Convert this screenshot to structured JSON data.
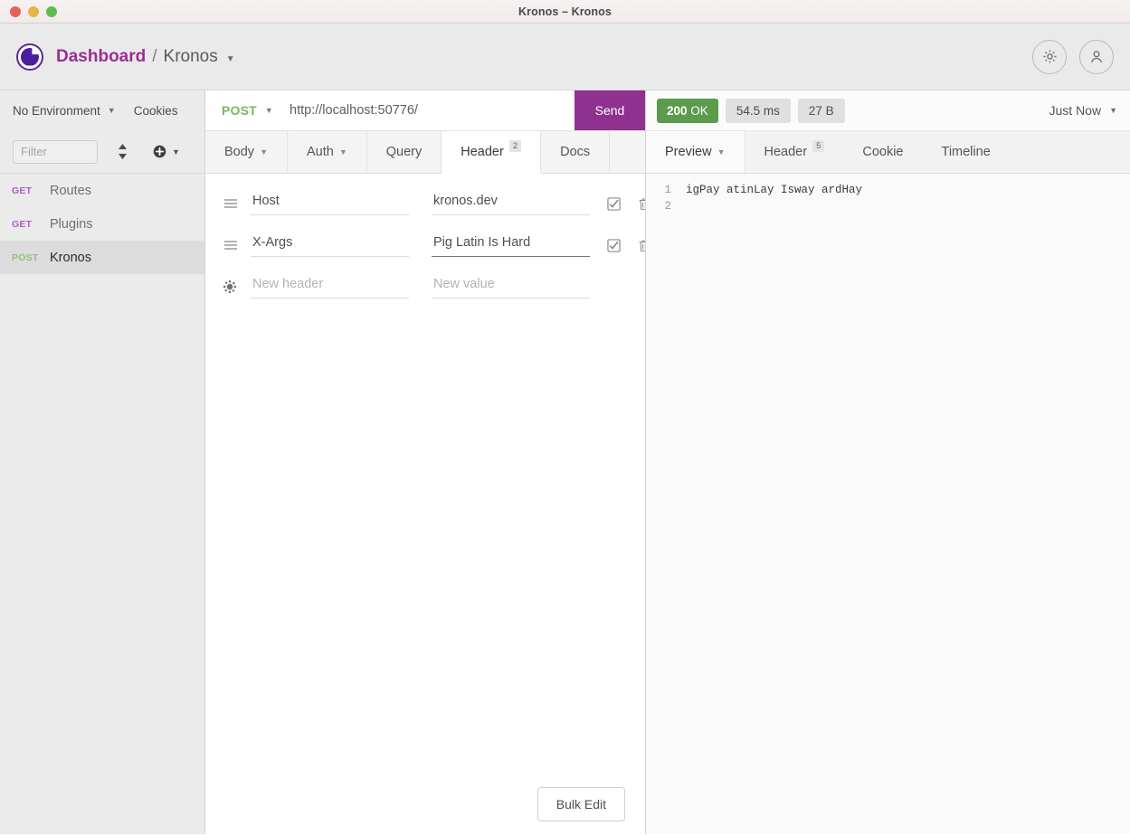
{
  "window": {
    "title": "Kronos – Kronos",
    "traffic_lights": [
      "close",
      "minimize",
      "zoom"
    ]
  },
  "header": {
    "breadcrumb_root": "Dashboard",
    "breadcrumb_sep": "/",
    "breadcrumb_current": "Kronos",
    "caret": "▼",
    "settings_icon": "gear-icon",
    "account_icon": "user-icon"
  },
  "sidebar": {
    "environment_label": "No Environment",
    "environment_caret": "▼",
    "cookies_label": "Cookies",
    "filter_placeholder": "Filter",
    "filter_value": "",
    "sort_icon": "sort-icon",
    "add_icon": "plus-circle-icon",
    "add_caret": "▼",
    "requests": [
      {
        "method": "GET",
        "name": "Routes",
        "selected": false
      },
      {
        "method": "GET",
        "name": "Plugins",
        "selected": false
      },
      {
        "method": "POST",
        "name": "Kronos",
        "selected": true
      }
    ]
  },
  "request": {
    "method": "POST",
    "method_caret": "▼",
    "url": "http://localhost:50776/",
    "send_label": "Send",
    "tabs": [
      {
        "label": "Body",
        "caret": "▼",
        "badge": "",
        "active": false
      },
      {
        "label": "Auth",
        "caret": "▼",
        "badge": "",
        "active": false
      },
      {
        "label": "Query",
        "caret": "",
        "badge": "",
        "active": false
      },
      {
        "label": "Header",
        "caret": "",
        "badge": "2",
        "active": true
      },
      {
        "label": "Docs",
        "caret": "",
        "badge": "",
        "active": false
      }
    ],
    "headers": [
      {
        "drag": "drag-handle-icon",
        "name": "Host",
        "value": "kronos.dev",
        "enabled": true,
        "focused": false
      },
      {
        "drag": "drag-handle-icon",
        "name": "X-Args",
        "value": "Pig Latin Is Hard",
        "enabled": true,
        "focused": true
      }
    ],
    "new_header": {
      "drag": "gear-icon",
      "name_placeholder": "New header",
      "value_placeholder": "New value",
      "name_value": "",
      "value_value": ""
    },
    "bulk_edit_label": "Bulk Edit"
  },
  "response": {
    "status_code": "200",
    "status_text": "OK",
    "time": "54.5 ms",
    "size": "27 B",
    "timestamp_label": "Just Now",
    "timestamp_caret": "▼",
    "tabs": [
      {
        "label": "Preview",
        "caret": "▼",
        "badge": "",
        "active": true
      },
      {
        "label": "Header",
        "caret": "",
        "badge": "5",
        "active": false
      },
      {
        "label": "Cookie",
        "caret": "",
        "badge": "",
        "active": false
      },
      {
        "label": "Timeline",
        "caret": "",
        "badge": "",
        "active": false
      }
    ],
    "body_lines": [
      "igPay atinLay Isway ardHay",
      ""
    ],
    "line_numbers": [
      "1",
      "2"
    ]
  },
  "colors": {
    "accent_purple": "#90318f",
    "brand_purple": "#9b2d93",
    "status_green": "#5c9b4b",
    "method_get": "#b05ec2",
    "method_post": "#8ec07a"
  }
}
